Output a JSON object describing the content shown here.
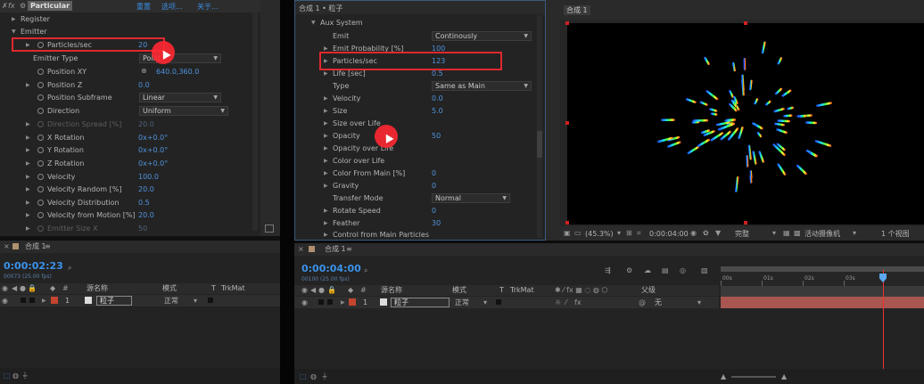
{
  "left_panel": {
    "effect_name": "Particular",
    "top_links": [
      "重置",
      "选项...",
      "关于..."
    ],
    "register": "Register",
    "emitter": "Emitter",
    "props": [
      {
        "label": "Particles/sec",
        "value": "20"
      },
      {
        "label": "Emitter Type",
        "value": "Point"
      },
      {
        "label": "Position XY",
        "value": "640.0,360.0"
      },
      {
        "label": "Position Z",
        "value": "0.0"
      },
      {
        "label": "Position Subframe",
        "value": "Linear"
      },
      {
        "label": "Direction",
        "value": "Uniform"
      },
      {
        "label": "Direction Spread [%]",
        "value": "20.0"
      },
      {
        "label": "X Rotation",
        "value": "0x+0.0°"
      },
      {
        "label": "Y Rotation",
        "value": "0x+0.0°"
      },
      {
        "label": "Z Rotation",
        "value": "0x+0.0°"
      },
      {
        "label": "Velocity",
        "value": "100.0"
      },
      {
        "label": "Velocity Random [%]",
        "value": "20.0"
      },
      {
        "label": "Velocity Distribution",
        "value": "0.5"
      },
      {
        "label": "Velocity from Motion [%]",
        "value": "20.0"
      },
      {
        "label": "Emitter Size X",
        "value": "50"
      }
    ]
  },
  "mid_panel": {
    "breadcrumb": "合成 1 • 粒子",
    "section": "Aux System",
    "props": [
      {
        "label": "Emit",
        "value": "Continously"
      },
      {
        "label": "Emit Probability [%]",
        "value": "100"
      },
      {
        "label": "Particles/sec",
        "value": "123"
      },
      {
        "label": "Life [sec]",
        "value": "0.5"
      },
      {
        "label": "Type",
        "value": "Same as Main"
      },
      {
        "label": "Velocity",
        "value": "0.0"
      },
      {
        "label": "Size",
        "value": "5.0"
      },
      {
        "label": "Size over Life",
        "value": ""
      },
      {
        "label": "Opacity",
        "value": "50"
      },
      {
        "label": "Opacity over Life",
        "value": ""
      },
      {
        "label": "Color over Life",
        "value": ""
      },
      {
        "label": "Color From Main [%]",
        "value": "0"
      },
      {
        "label": "Gravity",
        "value": "0"
      },
      {
        "label": "Transfer Mode",
        "value": "Normal"
      },
      {
        "label": "Rotate Speed",
        "value": "0"
      },
      {
        "label": "Feather",
        "value": "30"
      },
      {
        "label": "Control from Main Particles",
        "value": ""
      }
    ]
  },
  "viewer": {
    "tab": "合成 1",
    "zoom": "(45.3%)",
    "timecode": "0:00:04:00",
    "quality": "完整",
    "camera": "活动摄像机",
    "views": "1 个视图"
  },
  "timeline_left": {
    "tab": "合成 1",
    "timecode": "0:00:02:23",
    "frames": "00073 (25.00 fps)",
    "col_source": "源名称",
    "col_mode": "模式",
    "col_t": "T",
    "col_trkmat": "TrkMat",
    "layer_num": "1",
    "layer_name": "粒子",
    "layer_mode": "正常"
  },
  "timeline_right": {
    "tab": "合成 1",
    "timecode": "0:00:04:00",
    "frames": "00100 (25.00 fps)",
    "col_source": "源名称",
    "col_mode": "模式",
    "col_t": "T",
    "col_trkmat": "TrkMat",
    "col_parent": "父级",
    "layer_num": "1",
    "layer_name": "粒子",
    "layer_mode": "正常",
    "parent_value": "无",
    "ruler": [
      "00s",
      "01s",
      "02s",
      "03s"
    ],
    "playhead_fraction": 0.8
  },
  "colors": {
    "accent": "#3b92ea",
    "highlight": "#e0282e",
    "layer_bar": "#a8564f"
  }
}
